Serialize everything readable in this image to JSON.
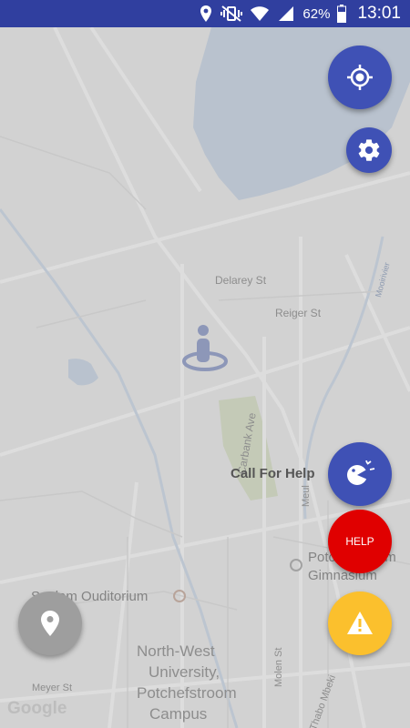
{
  "status_bar": {
    "battery": "62%",
    "time": "13:01",
    "icons": [
      "location-icon",
      "vibrate-icon",
      "wifi-icon",
      "signal-icon",
      "battery-icon"
    ]
  },
  "map": {
    "streets": {
      "delarey": "Delarey St",
      "reiger": "Reiger St",
      "carbank": "Carbank Ave",
      "meyer": "Meyer St",
      "molen": "Molen St",
      "thabo": "Thabo Mbeki",
      "moot": "Mooirivier",
      "meul": "Meul"
    },
    "places": {
      "auditorium": "Sanlam Ouditorium",
      "gymnasium_1": "Potchefstroom",
      "gymnasium_2": "Gimnasium",
      "university_1": "North-West",
      "university_2": "University,",
      "university_3": "Potchefstroom",
      "university_4": "Campus"
    },
    "attribution": "Google"
  },
  "actions": {
    "call_for_help": "Call For Help",
    "help": "HELP"
  },
  "colors": {
    "primary": "#3f51b5",
    "status_bar": "#303f9f",
    "help": "#e00000",
    "warning": "#fbc02d",
    "marker_button": "#9e9e9e"
  }
}
